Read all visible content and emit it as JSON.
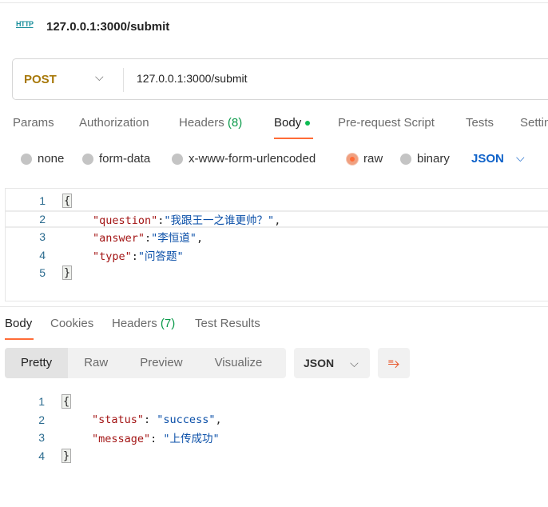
{
  "header": {
    "protocol_icon": "http-icon",
    "protocol_label": "HTTP",
    "title": "127.0.0.1:3000/submit"
  },
  "request": {
    "method": "POST",
    "url": "127.0.0.1:3000/submit"
  },
  "tabs": [
    {
      "label": "Params"
    },
    {
      "label": "Authorization"
    },
    {
      "label": "Headers",
      "count": "(8)"
    },
    {
      "label": "Body",
      "active": true
    },
    {
      "label": "Pre-request Script"
    },
    {
      "label": "Tests"
    },
    {
      "label": "Settings"
    }
  ],
  "body_types": [
    {
      "label": "none"
    },
    {
      "label": "form-data"
    },
    {
      "label": "x-www-form-urlencoded"
    },
    {
      "label": "raw",
      "selected": true
    },
    {
      "label": "binary"
    }
  ],
  "body_format": "JSON",
  "request_body": {
    "lines": [
      {
        "n": "1",
        "text": "{"
      },
      {
        "n": "2",
        "key": "\"question\"",
        "sep": ":",
        "val": "\"我跟王一之谁更帅？\"",
        "end": ","
      },
      {
        "n": "3",
        "key": "\"answer\"",
        "sep": ":",
        "val": "\"李恒道\"",
        "end": ","
      },
      {
        "n": "4",
        "key": "\"type\"",
        "sep": ":",
        "val": "\"问答题\"",
        "end": ""
      },
      {
        "n": "5",
        "text": "}"
      }
    ]
  },
  "response_tabs": [
    {
      "label": "Body",
      "active": true
    },
    {
      "label": "Cookies"
    },
    {
      "label": "Headers",
      "count": "(7)"
    },
    {
      "label": "Test Results"
    }
  ],
  "view_modes": [
    "Pretty",
    "Raw",
    "Preview",
    "Visualize"
  ],
  "response_format": "JSON",
  "response_body": {
    "lines": [
      {
        "n": "1",
        "text": "{"
      },
      {
        "n": "2",
        "key": "\"status\"",
        "sep": ": ",
        "val": "\"success\"",
        "end": ","
      },
      {
        "n": "3",
        "key": "\"message\"",
        "sep": ": ",
        "val": "\"上传成功\"",
        "end": ""
      },
      {
        "n": "4",
        "text": "}"
      }
    ]
  },
  "colors": {
    "accent": "#ff6c37",
    "method": "#a8790a",
    "link": "#0f62c9",
    "count": "#0a9a4a"
  }
}
